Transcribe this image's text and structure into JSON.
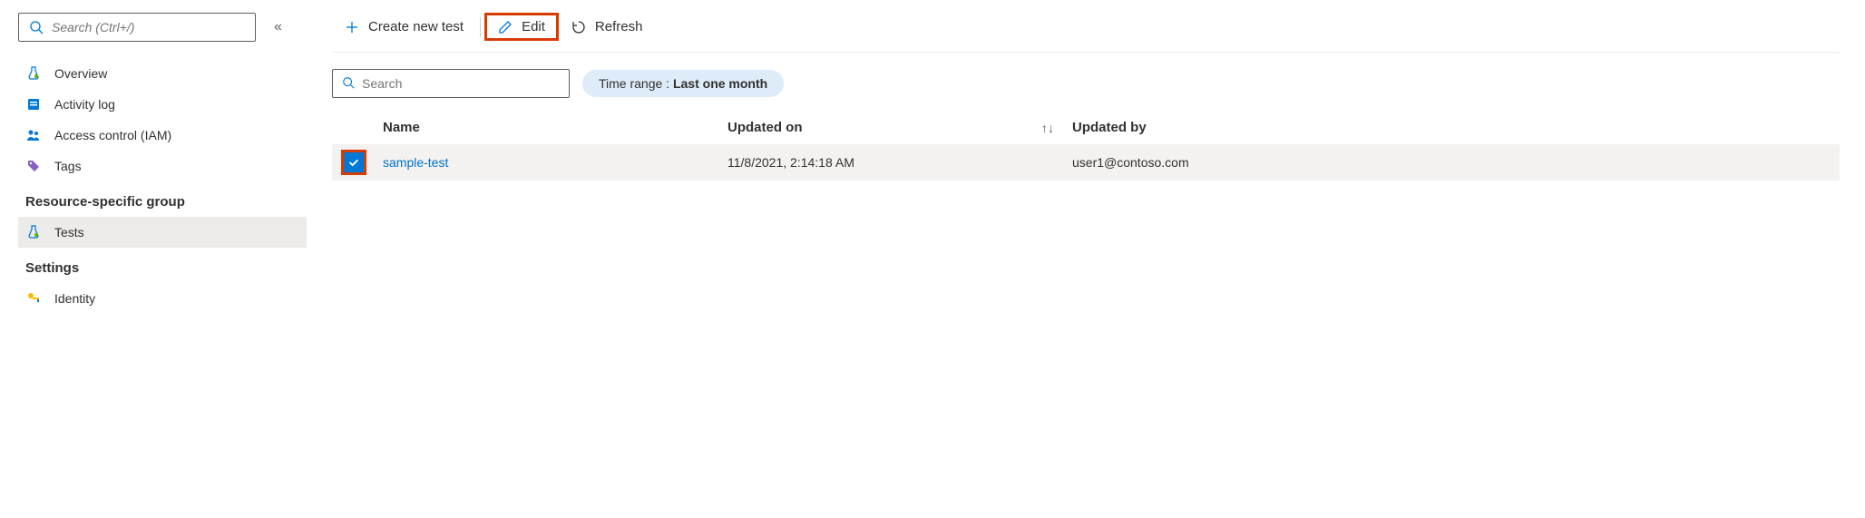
{
  "sidebar": {
    "search_placeholder": "Search (Ctrl+/)",
    "items": [
      {
        "label": "Overview"
      },
      {
        "label": "Activity log"
      },
      {
        "label": "Access control (IAM)"
      },
      {
        "label": "Tags"
      }
    ],
    "group1_header": "Resource-specific group",
    "group1_items": [
      {
        "label": "Tests"
      }
    ],
    "group2_header": "Settings",
    "group2_items": [
      {
        "label": "Identity"
      }
    ]
  },
  "toolbar": {
    "create_label": "Create new test",
    "edit_label": "Edit",
    "refresh_label": "Refresh"
  },
  "filter": {
    "search_placeholder": "Search",
    "time_range_label": "Time range : ",
    "time_range_value": "Last one month"
  },
  "table": {
    "columns": {
      "name": "Name",
      "updated_on": "Updated on",
      "updated_by": "Updated by"
    },
    "rows": [
      {
        "name": "sample-test",
        "updated_on": "11/8/2021, 2:14:18 AM",
        "updated_by": "user1@contoso.com"
      }
    ]
  },
  "colors": {
    "link": "#0072c9",
    "accent": "#0078d4",
    "highlight": "#d83b01"
  }
}
